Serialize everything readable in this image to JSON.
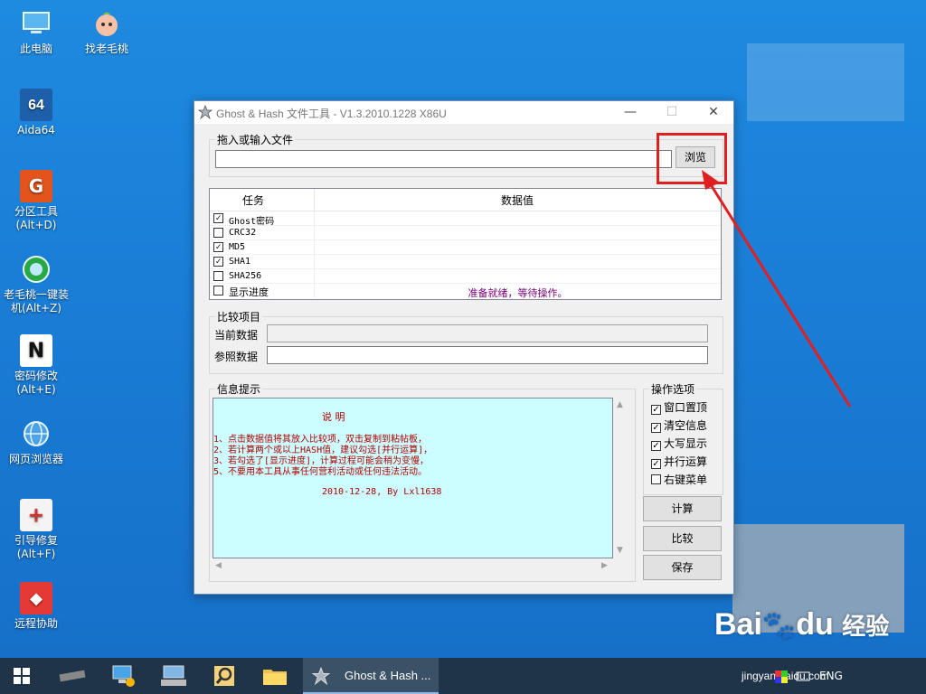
{
  "desktop": {
    "icons": [
      {
        "label": "此电脑",
        "icon": "computer-icon"
      },
      {
        "label": "找老毛桃",
        "icon": "peach-icon"
      },
      {
        "label": "Aida64",
        "icon": "aida64-icon",
        "glyph": "64"
      },
      {
        "label": "分区工具",
        "label2": "(Alt+D)",
        "icon": "partition-tool-icon",
        "glyph": "G"
      },
      {
        "label": "老毛桃一键装",
        "label2": "机(Alt+Z)",
        "icon": "install-icon"
      },
      {
        "label": "密码修改",
        "label2": "(Alt+E)",
        "icon": "password-icon",
        "glyph": "N"
      },
      {
        "label": "网页浏览器",
        "icon": "browser-icon"
      },
      {
        "label": "引导修复",
        "label2": "(Alt+F)",
        "icon": "boot-repair-icon",
        "glyph": "+"
      },
      {
        "label": "远程协助",
        "icon": "remote-assist-icon",
        "glyph": "◆"
      }
    ]
  },
  "window": {
    "title": "Ghost & Hash 文件工具 - V1.3.2010.1228 X86U",
    "minimize": "—",
    "maximize": "☐",
    "close": "✕",
    "file_group": {
      "legend": "拖入或输入文件",
      "input_value": "",
      "browse_label": "浏览"
    },
    "table": {
      "col_task": "任务",
      "col_value": "数据值",
      "rows": [
        {
          "label": "Ghost密码",
          "checked": true,
          "value": ""
        },
        {
          "label": "CRC32",
          "checked": false,
          "value": ""
        },
        {
          "label": "MD5",
          "checked": true,
          "value": ""
        },
        {
          "label": "SHA1",
          "checked": true,
          "value": ""
        },
        {
          "label": "SHA256",
          "checked": false,
          "value": ""
        },
        {
          "label": "显示进度",
          "checked": false,
          "value": "准备就绪，等待操作。"
        }
      ]
    },
    "compare_group": {
      "legend": "比较项目",
      "current_label": "当前数据",
      "current_value": "",
      "reference_label": "参照数据",
      "reference_value": ""
    },
    "info_group": {
      "legend": "信息提示",
      "heading": "说 明",
      "lines": [
        "1、点击数据值将其放入比较项，双击复制到粘帖板，",
        "2、若计算两个或以上HASH值，建议勾选[并行运算]，",
        "3、若勾选了[显示进度]，计算过程可能会稍为变慢，",
        "5、不要用本工具从事任何营利活动或任何违法活动。"
      ],
      "signature": "2010-12-28, By Lxl1638"
    },
    "options_group": {
      "legend": "操作选项",
      "items": [
        {
          "label": "窗口置顶",
          "checked": true
        },
        {
          "label": "清空信息",
          "checked": true
        },
        {
          "label": "大写显示",
          "checked": true
        },
        {
          "label": "并行运算",
          "checked": true
        },
        {
          "label": "右键菜单",
          "checked": false
        }
      ]
    },
    "buttons": {
      "calculate": "计算",
      "compare": "比较",
      "save": "保存"
    }
  },
  "taskbar": {
    "active_app": "Ghost & Hash ...",
    "lang": "ENG",
    "watermark": "jingyan.baidu.com",
    "baidu": "Bai",
    "baidu2": "du",
    "jingyan": "经验"
  },
  "colors": {
    "annotation": "#e02020",
    "info_bg": "#ccfeff",
    "info_text": "#b00000",
    "status_text": "#7a0077"
  }
}
